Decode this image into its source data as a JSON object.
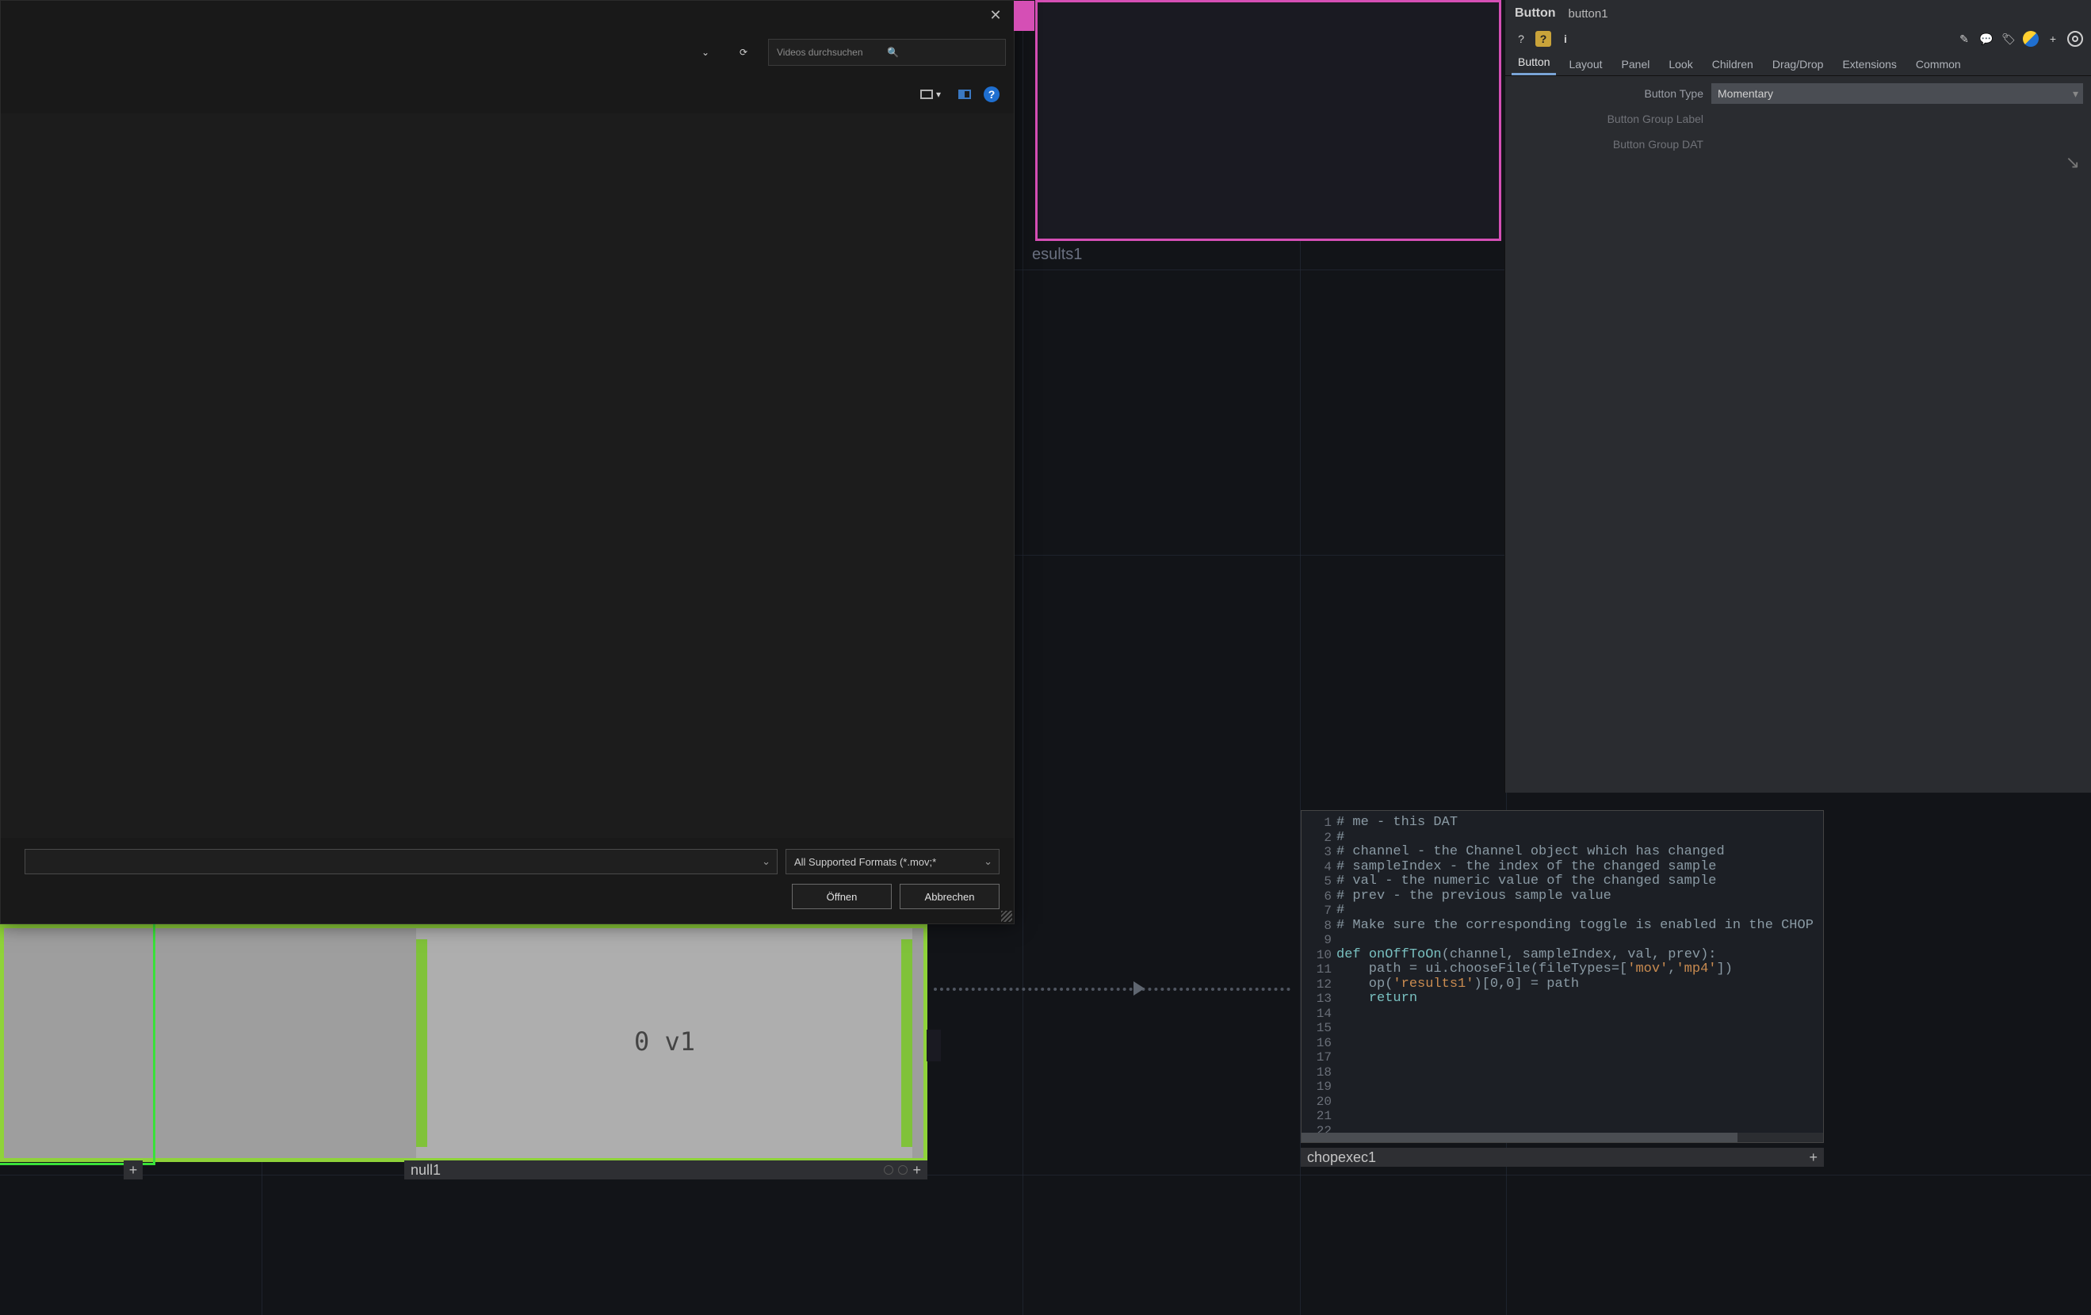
{
  "canvas": {
    "preview_label": "esults1",
    "null_node": {
      "text": "0 v1",
      "footer": "null1"
    },
    "code_node": {
      "footer": "chopexec1",
      "lines": [
        "# me - this DAT",
        "#",
        "# channel - the Channel object which has changed",
        "# sampleIndex - the index of the changed sample",
        "# val - the numeric value of the changed sample",
        "# prev - the previous sample value",
        "#",
        "# Make sure the corresponding toggle is enabled in the CHOP",
        "",
        "def onOffToOn(channel, sampleIndex, val, prev):",
        "    path = ui.chooseFile(fileTypes=['mov','mp4'])",
        "    op('results1')[0,0] = path",
        "    return"
      ]
    }
  },
  "dialog": {
    "search_placeholder": "Videos durchsuchen",
    "filetype": "All Supported Formats (*.mov;*",
    "open": "Öffnen",
    "cancel": "Abbrechen"
  },
  "params": {
    "type": "Button",
    "name": "button1",
    "tabs": [
      "Button",
      "Layout",
      "Panel",
      "Look",
      "Children",
      "Drag/Drop",
      "Extensions",
      "Common"
    ],
    "active_tab": "Button",
    "rows": {
      "button_type_label": "Button Type",
      "button_type_value": "Momentary",
      "group_label": "Button Group Label",
      "group_dat": "Button Group DAT"
    }
  }
}
